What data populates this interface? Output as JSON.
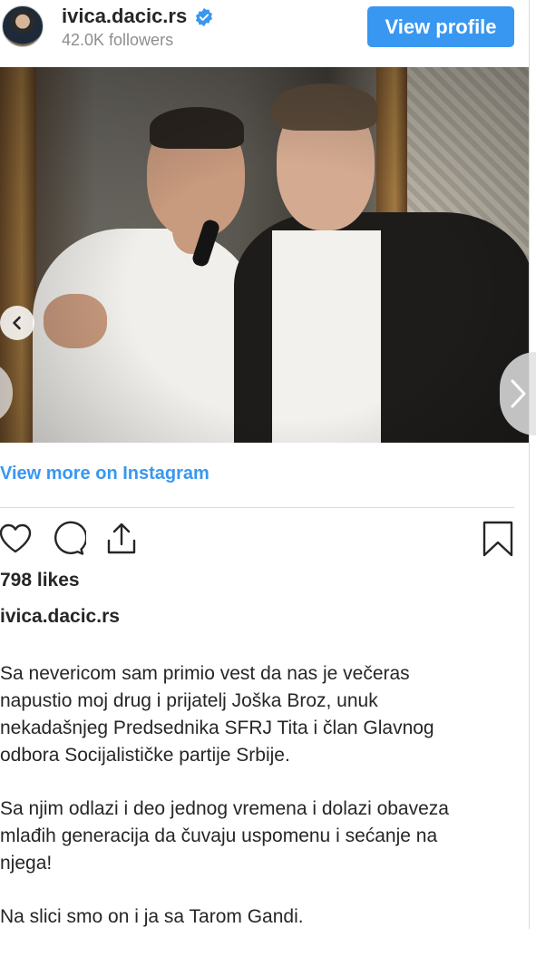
{
  "header": {
    "username": "ivica.dacic.rs",
    "followers": "42.0K followers",
    "view_profile_label": "View profile"
  },
  "carousel": {
    "total": 2,
    "active_index": 2
  },
  "links": {
    "view_more": "View more on Instagram"
  },
  "stats": {
    "likes": "798 likes"
  },
  "caption": {
    "username": "ivica.dacic.rs",
    "paragraph1": [
      "Sa nevericom sam primio vest da nas je večeras",
      "napustio moj drug i prijatelj Joška Broz, unuk",
      "nekadašnjeg Predsednika SFRJ Tita i član Glavnog",
      "odbora Socijalističke partije Srbije."
    ],
    "paragraph2": [
      "Sa njim odlazi i deo jednog vremena i dolazi obaveza",
      "mlađih generacija da čuvaju uspomenu i sećanje na",
      "njega!"
    ],
    "paragraph3": [
      "Na slici smo on i ja sa Tarom Gandi."
    ]
  },
  "icons": [
    "verified-icon",
    "chevron-left-icon",
    "chevron-right-icon",
    "heart-icon",
    "comment-icon",
    "share-icon",
    "bookmark-icon"
  ],
  "colors": {
    "accent": "#3897f0",
    "text": "#262626",
    "muted": "#8e8e8e"
  }
}
